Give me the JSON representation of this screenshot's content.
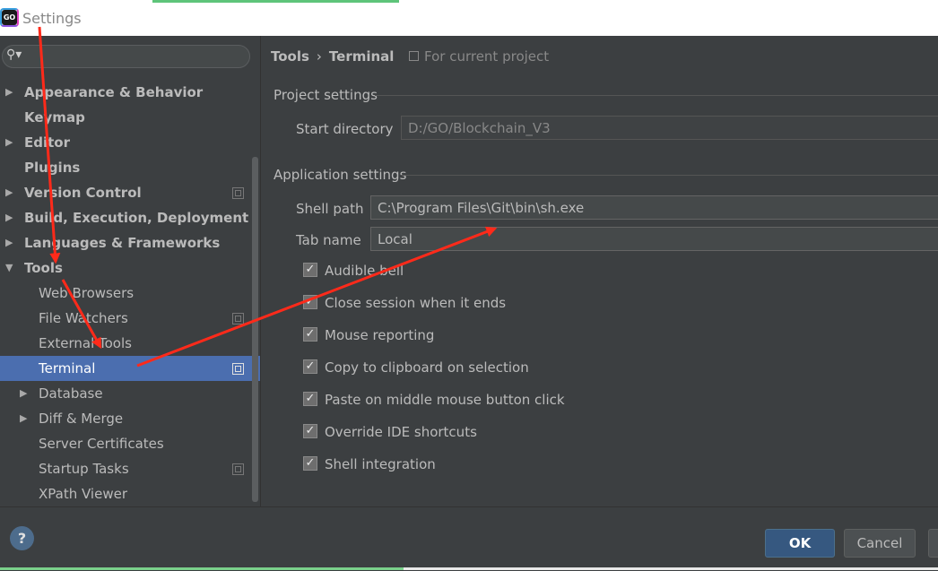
{
  "window": {
    "title": "Settings",
    "logo_text": "GO"
  },
  "search": {
    "placeholder": "",
    "icon": "search-icon"
  },
  "sidebar": {
    "items": [
      {
        "label": "Appearance & Behavior",
        "arrow": "▶",
        "level": 0,
        "bold": true
      },
      {
        "label": "Keymap",
        "arrow": "",
        "level": 0,
        "bold": true
      },
      {
        "label": "Editor",
        "arrow": "▶",
        "level": 0,
        "bold": true
      },
      {
        "label": "Plugins",
        "arrow": "",
        "level": 0,
        "bold": true
      },
      {
        "label": "Version Control",
        "arrow": "▶",
        "level": 0,
        "bold": true,
        "project_scope": true
      },
      {
        "label": "Build, Execution, Deployment",
        "arrow": "▶",
        "level": 0,
        "bold": true
      },
      {
        "label": "Languages & Frameworks",
        "arrow": "▶",
        "level": 0,
        "bold": true
      },
      {
        "label": "Tools",
        "arrow": "▼",
        "level": 0,
        "bold": true
      },
      {
        "label": "Web Browsers",
        "arrow": "",
        "level": 1
      },
      {
        "label": "File Watchers",
        "arrow": "",
        "level": 1,
        "project_scope": true
      },
      {
        "label": "External Tools",
        "arrow": "",
        "level": 1
      },
      {
        "label": "Terminal",
        "arrow": "",
        "level": 1,
        "project_scope": true,
        "selected": true
      },
      {
        "label": "Database",
        "arrow": "▶",
        "level": 1
      },
      {
        "label": "Diff & Merge",
        "arrow": "▶",
        "level": 1
      },
      {
        "label": "Server Certificates",
        "arrow": "",
        "level": 1
      },
      {
        "label": "Startup Tasks",
        "arrow": "",
        "level": 1,
        "project_scope": true
      },
      {
        "label": "XPath Viewer",
        "arrow": "",
        "level": 1
      }
    ]
  },
  "breadcrumb": {
    "parent": "Tools",
    "separator": "›",
    "current": "Terminal",
    "scope": "For current project"
  },
  "project_settings": {
    "heading": "Project settings",
    "start_directory_label": "Start directory",
    "start_directory_value": "D:/GO/Blockchain_V3"
  },
  "application_settings": {
    "heading": "Application settings",
    "shell_path_label": "Shell path",
    "shell_path_value": "C:\\Program Files\\Git\\bin\\sh.exe",
    "tab_name_label": "Tab name",
    "tab_name_value": "Local"
  },
  "checkboxes": [
    {
      "label": "Audible bell",
      "checked": true
    },
    {
      "label": "Close session when it ends",
      "checked": true
    },
    {
      "label": "Mouse reporting",
      "checked": true
    },
    {
      "label": "Copy to clipboard on selection",
      "checked": true
    },
    {
      "label": "Paste on middle mouse button click",
      "checked": true
    },
    {
      "label": "Override IDE shortcuts",
      "checked": true
    },
    {
      "label": "Shell integration",
      "checked": true
    }
  ],
  "footer": {
    "help_label": "?",
    "ok_label": "OK",
    "cancel_label": "Cancel"
  },
  "colors": {
    "selection": "#4b6eaf",
    "background": "#3c3f41",
    "annotation_arrow": "#ff2a1a"
  }
}
